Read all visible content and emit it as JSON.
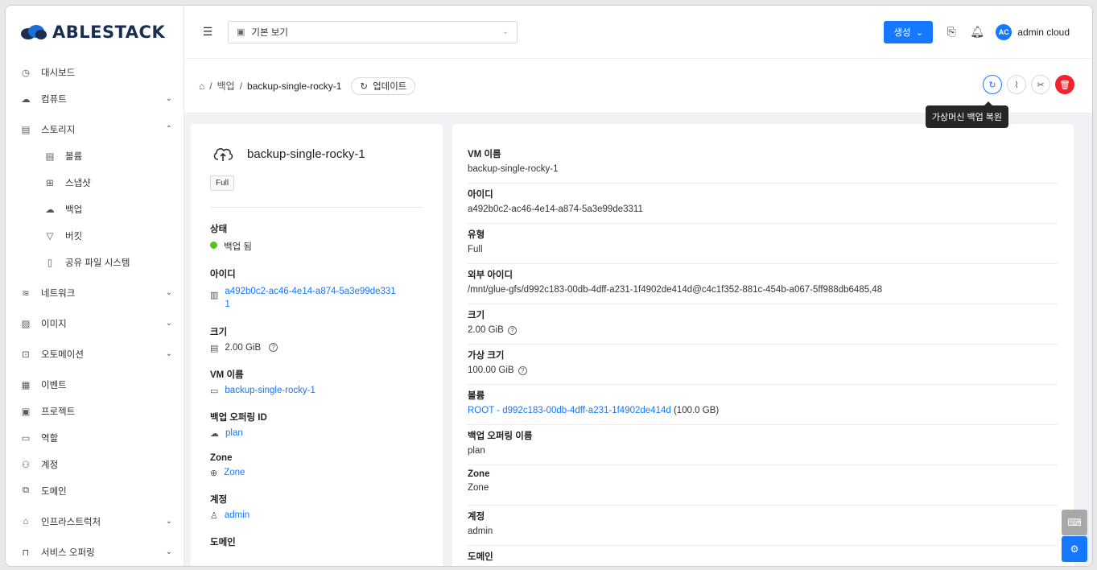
{
  "app": {
    "logo": "ABLESTACK",
    "accent": "#1677ff"
  },
  "sidebar": {
    "items": [
      {
        "label": "대시보드",
        "icon": "dashboard-icon",
        "chevron": ""
      },
      {
        "label": "컴퓨트",
        "icon": "cloud-icon",
        "chevron": "⌄"
      },
      {
        "label": "스토리지",
        "icon": "storage-icon",
        "chevron": "⌃"
      },
      {
        "label": "볼륨",
        "icon": "volume-icon",
        "chevron": ""
      },
      {
        "label": "스냅샷",
        "icon": "snapshot-icon",
        "chevron": ""
      },
      {
        "label": "백업",
        "icon": "backup-icon",
        "chevron": ""
      },
      {
        "label": "버킷",
        "icon": "bucket-icon",
        "chevron": ""
      },
      {
        "label": "공유 파일 시스템",
        "icon": "file-icon",
        "chevron": ""
      },
      {
        "label": "네트워크",
        "icon": "wifi-icon",
        "chevron": "⌄"
      },
      {
        "label": "이미지",
        "icon": "image-icon",
        "chevron": "⌄"
      },
      {
        "label": "오토메이션",
        "icon": "automation-icon",
        "chevron": "⌄"
      },
      {
        "label": "이벤트",
        "icon": "calendar-icon",
        "chevron": ""
      },
      {
        "label": "프로젝트",
        "icon": "project-icon",
        "chevron": ""
      },
      {
        "label": "역할",
        "icon": "role-icon",
        "chevron": ""
      },
      {
        "label": "계정",
        "icon": "team-icon",
        "chevron": ""
      },
      {
        "label": "도메인",
        "icon": "domain-icon",
        "chevron": ""
      },
      {
        "label": "인프라스트럭처",
        "icon": "bank-icon",
        "chevron": "⌄"
      },
      {
        "label": "서비스 오퍼링",
        "icon": "shopping-icon",
        "chevron": "⌄"
      }
    ]
  },
  "header": {
    "view_select": "기본 보기",
    "create_label": "생성",
    "user_initials": "AC",
    "user_name": "admin cloud"
  },
  "breadcrumb": {
    "parent": "백업",
    "sep": "/",
    "current": "backup-single-rocky-1",
    "refresh_label": "업데이트"
  },
  "tooltip": "가상머신 백업 복원",
  "summary": {
    "name": "backup-single-rocky-1",
    "tag": "Full",
    "state_label": "상태",
    "state_value": "백업 됨",
    "id_label": "아이디",
    "id_value": "a492b0c2-ac46-4e14-a874-5a3e99de331",
    "id_value_tail": "1",
    "size_label": "크기",
    "size_value": "2.00 GiB",
    "vm_label": "VM 이름",
    "vm_value": "backup-single-rocky-1",
    "offering_label": "백업 오퍼링 ID",
    "offering_value": "plan",
    "zone_label": "Zone",
    "zone_value": "Zone",
    "account_label": "계정",
    "account_value": "admin",
    "domain_label": "도메인"
  },
  "details": [
    {
      "key": "VM 이름",
      "value": "backup-single-rocky-1"
    },
    {
      "key": "아이디",
      "value": "a492b0c2-ac46-4e14-a874-5a3e99de3311"
    },
    {
      "key": "유형",
      "value": "Full"
    },
    {
      "key": "외부 아이디",
      "value": "/mnt/glue-gfs/d992c183-00db-4dff-a231-1f4902de414d@c4c1f352-881c-454b-a067-5ff988db6485,48"
    },
    {
      "key": "크기",
      "value": "2.00 GiB"
    },
    {
      "key": "가상 크기",
      "value": "100.00 GiB"
    },
    {
      "key": "볼륨",
      "value": "ROOT - d992c183-00db-4dff-a231-1f4902de414d",
      "suffix": "(100.0 GB)"
    },
    {
      "key": "백업 오퍼링 이름",
      "value": "plan"
    },
    {
      "key": "Zone",
      "value": "Zone"
    },
    {
      "key": "계정",
      "value": "admin"
    },
    {
      "key": "도메인",
      "value": ""
    }
  ]
}
